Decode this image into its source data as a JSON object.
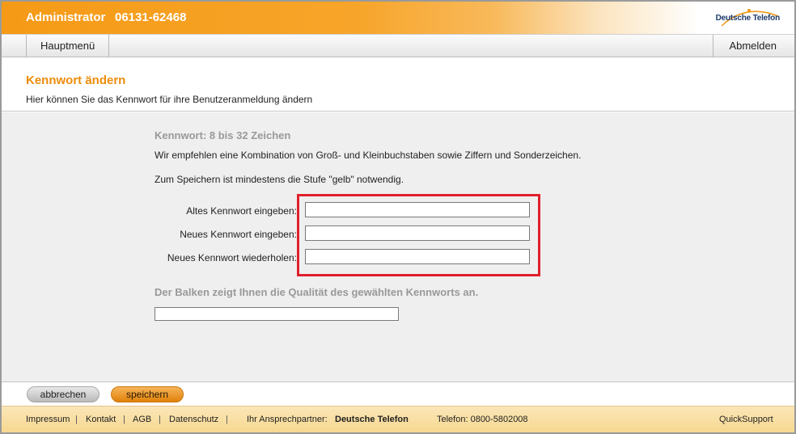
{
  "header": {
    "user": "Administrator",
    "phone": "06131-62468",
    "brand": "Deutsche Telefon"
  },
  "nav": {
    "main_menu": "Hauptmenü",
    "logout": "Abmelden"
  },
  "page": {
    "title": "Kennwort ändern",
    "subtitle": "Hier können Sie das Kennwort für ihre Benutzeranmeldung ändern"
  },
  "info": {
    "title": "Kennwort: 8 bis 32 Zeichen",
    "line1": "Wir empfehlen eine Kombination von Groß- und Kleinbuchstaben sowie Ziffern und Sonderzeichen.",
    "line2": "Zum Speichern ist mindestens die Stufe \"gelb\" notwendig."
  },
  "form": {
    "old_label": "Altes Kennwort eingeben:",
    "old_value": "",
    "new_label": "Neues Kennwort eingeben:",
    "new_value": "",
    "repeat_label": "Neues Kennwort wiederholen:",
    "repeat_value": ""
  },
  "quality": {
    "title": "Der Balken zeigt Ihnen die Qualität des gewählten Kennworts an.",
    "level": 0
  },
  "buttons": {
    "cancel": "abbrechen",
    "save": "speichern"
  },
  "footer": {
    "impressum": "Impressum",
    "kontakt": "Kontakt",
    "agb": "AGB",
    "datenschutz": "Datenschutz",
    "partner_label": "Ihr Ansprechpartner:",
    "partner_name": "Deutsche Telefon",
    "phone": "Telefon: 0800-5802008",
    "quicksupport": "QuickSupport"
  },
  "colors": {
    "accent": "#ee8c0b",
    "highlight_box": "#e0202c"
  }
}
